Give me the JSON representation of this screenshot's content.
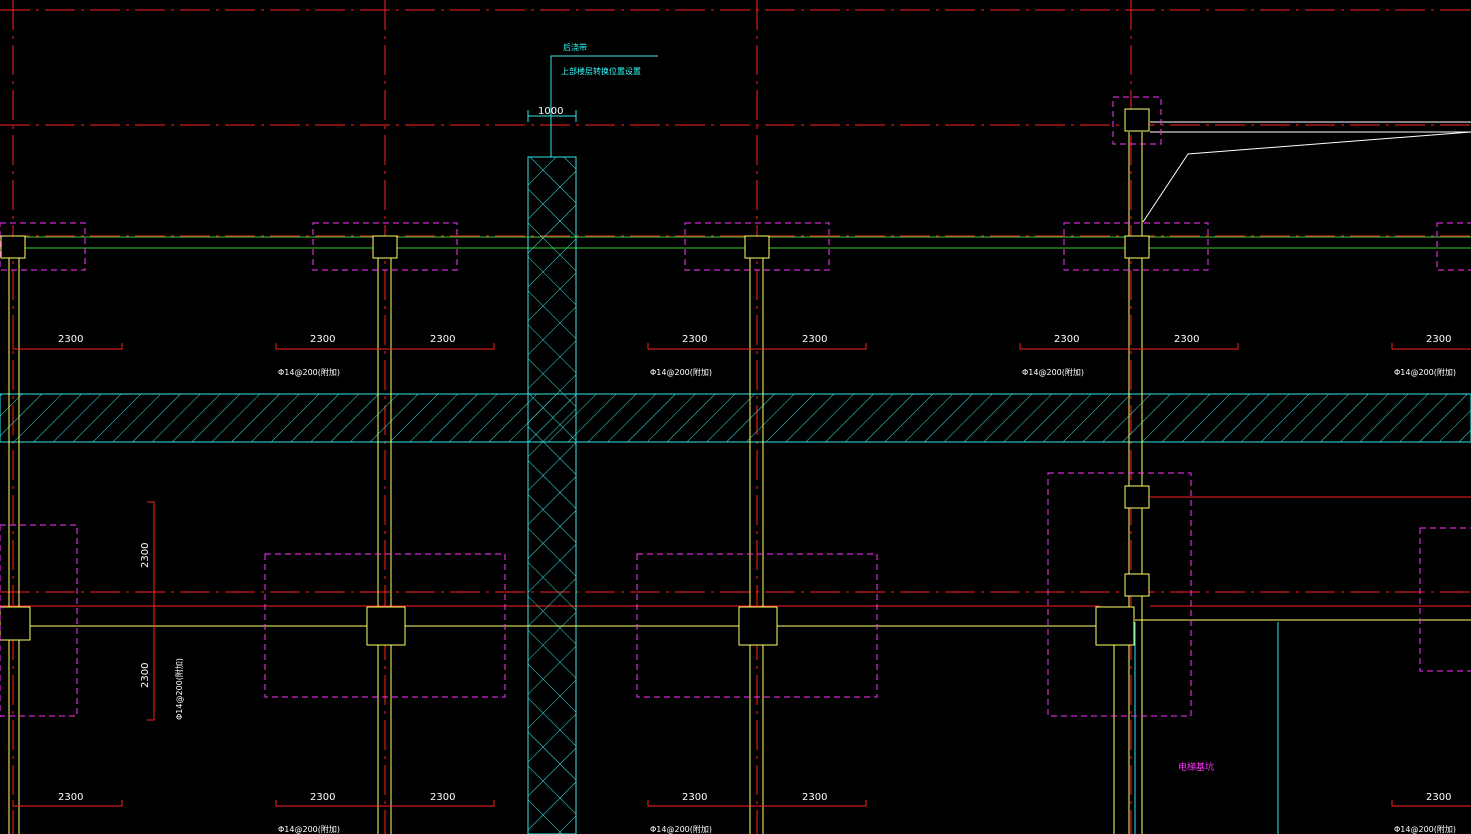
{
  "drawing": {
    "background": "#000000",
    "colors": {
      "axis": "#ff2020",
      "column": "#ffff66",
      "cap": "#ff33ff",
      "hatch": "#33e6e6",
      "green": "#33cc33",
      "white": "#ffffff",
      "dim_text": "#ffffff",
      "label_cyan": "#33ffff",
      "label_magenta": "#ff33ff"
    },
    "dimension_1000": "1000",
    "dim_2300": "2300",
    "rebar_note": "Φ14@200(附加)",
    "annotation_line1": "后浇带",
    "annotation_line2": "上部楼层转换位置设置",
    "elevator_label": "电梯基坑",
    "icons": [
      "cad-grid-axis",
      "hatch-strip",
      "crosshatch-post-pour-band"
    ]
  }
}
